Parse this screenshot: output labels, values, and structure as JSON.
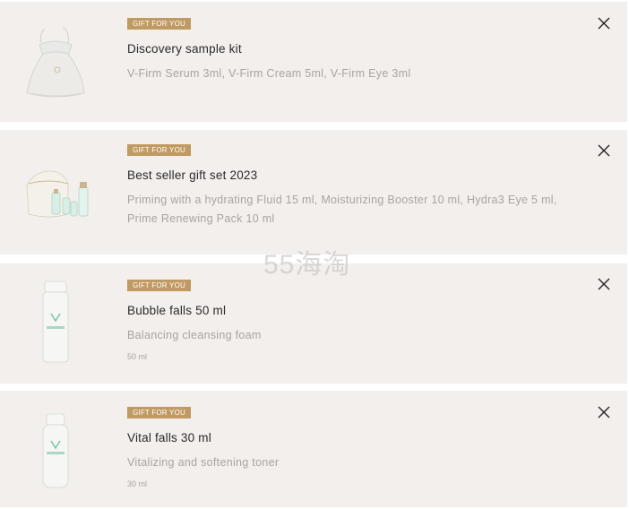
{
  "items": [
    {
      "badge": "GIFT FOR YOU",
      "title": "Discovery sample kit",
      "description": "V-Firm Serum 3ml, V-Firm Cream 5ml, V-Firm Eye 3ml",
      "size": "",
      "image_icon": "pouch-icon"
    },
    {
      "badge": "GIFT FOR YOU",
      "title": "Best seller gift set 2023",
      "description": "Priming with a hydrating Fluid 15 ml, Moisturizing Booster 10 ml, Hydra3 Eye 5 ml, Prime Renewing Pack 10 ml",
      "size": "",
      "image_icon": "gift-set-icon"
    },
    {
      "badge": "GIFT FOR YOU",
      "title": "Bubble falls 50 ml",
      "description": "Balancing cleansing foam",
      "size": "50 ml",
      "image_icon": "foam-bottle-icon"
    },
    {
      "badge": "GIFT FOR YOU",
      "title": "Vital falls 30 ml",
      "description": "Vitalizing and softening toner",
      "size": "30 ml",
      "image_icon": "toner-bottle-icon"
    }
  ],
  "close_icon": "close-icon",
  "watermark": "55海淘",
  "colors": {
    "card_bg": "#f3efed",
    "badge_bg": "#c19a62",
    "title": "#2a2a2a",
    "muted": "#a8a4a2"
  }
}
